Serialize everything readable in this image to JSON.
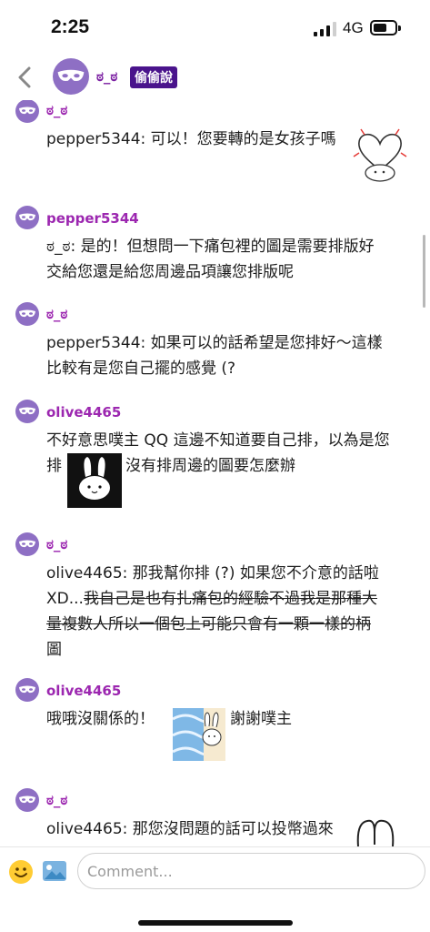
{
  "status_bar": {
    "time": "2:25",
    "network": "4G"
  },
  "header": {
    "name": "ಠ_ಠ",
    "badge": "偷偷說"
  },
  "messages": [
    {
      "user": "ಠ_ಠ",
      "text": "pepper5344: 可以！您要轉的是女孩子嗎"
    },
    {
      "user": "pepper5344",
      "line1": "ಠ_ಠ: 是的！但想問一下痛包裡的圖是需要排版好",
      "line2": "交給您還是給您周邊品項讓您排版呢"
    },
    {
      "user": "ಠ_ಠ",
      "line1": "pepper5344: 如果可以的話希望是您排好～這樣",
      "line2": "比較有是您自己擺的感覺 (?"
    },
    {
      "user": "olive4465",
      "line1": "不好意思噗主 QQ 這邊不知道要自己排，以為是您",
      "line2a": "排",
      "line2b": "沒有排周邊的圖要怎麼辦"
    },
    {
      "user": "ಠ_ಠ",
      "line1": "olive4465: 那我幫你排 (?) 如果您不介意的話啦",
      "line2a": "XD...",
      "line2b": "我自己是也有扎痛包的經驗不過我是那種大",
      "line3": "量複數人所以一個包上可能只會有一顆一樣的柄",
      "line4": "圖"
    },
    {
      "user": "olive4465",
      "text_a": "哦哦沒關係的！",
      "text_b": "謝謝噗主"
    },
    {
      "user": "ಠ_ಠ",
      "text": "olive4465: 那您沒問題的話可以投幣過來"
    }
  ],
  "composer": {
    "placeholder": "Comment..."
  },
  "icons": {
    "back": "chevron-left-icon",
    "avatar": "mask-icon",
    "emoji": "smiley-icon",
    "photo": "image-icon"
  },
  "colors": {
    "accent": "#9c27b0",
    "badge": "#4a148c",
    "avatar": "#8e6fc4"
  }
}
